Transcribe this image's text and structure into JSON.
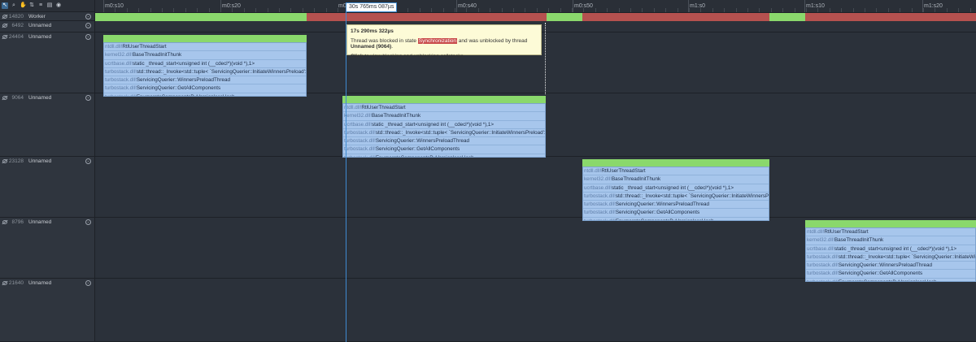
{
  "toolbar": {
    "icons": [
      "select-icon",
      "zoom-icon",
      "pan-icon",
      "sort-icon",
      "filter-icon",
      "document-icon",
      "eye-icon"
    ]
  },
  "ruler": {
    "labels": [
      "m0:s10",
      "m0:s20",
      "m0:s40",
      "m0:s50",
      "m1:s0",
      "m1:s10",
      "m1:s20"
    ],
    "partial_label": "m0"
  },
  "cursor": {
    "label": "30s 765ms 087µs"
  },
  "threads": [
    {
      "id": "14820",
      "name": "Worker"
    },
    {
      "id": "6492",
      "name": "Unnamed"
    },
    {
      "id": "24404",
      "name": "Unnamed"
    },
    {
      "id": "9064",
      "name": "Unnamed"
    },
    {
      "id": "23128",
      "name": "Unnamed"
    },
    {
      "id": "8796",
      "name": "Unnamed"
    },
    {
      "id": "21640",
      "name": "Unnamed"
    }
  ],
  "stacks": {
    "t24404": [
      {
        "mod": "ntdll.dll!",
        "fn": "RtlUserThreadStart"
      },
      {
        "mod": "kernel32.dll!",
        "fn": "BaseThreadInitThunk"
      },
      {
        "mod": "ucrtbase.dll!",
        "fn": "static _thread_start<unsigned int (__cdecl*)(void *),1>"
      },
      {
        "mod": "turbostack.dll!",
        "fn": "std::thread::_Invoke<std::tuple< `ServicingQuerier::InitiateWinnersPreload'::`3'::<l"
      },
      {
        "mod": "turbostack.dll!",
        "fn": "ServicingQuerier::WinnersPreloadThread"
      },
      {
        "mod": "turbostack.dll!",
        "fn": "ServicingQuerier::GetAllComponents"
      },
      {
        "mod": "turbostack.dll!",
        "fn": "EnumerateComponentsByVersionlessHash"
      }
    ],
    "t9064": [
      {
        "mod": "ntdll.dll!",
        "fn": "RtlUserThreadStart"
      },
      {
        "mod": "kernel32.dll!",
        "fn": "BaseThreadInitThunk"
      },
      {
        "mod": "ucrtbase.dll!",
        "fn": "static _thread_start<unsigned int (__cdecl*)(void *),1>"
      },
      {
        "mod": "turbostack.dll!",
        "fn": "std::thread::_Invoke<std::tuple< `ServicingQuerier::InitiateWinnersPreload'::`3'::<l"
      },
      {
        "mod": "turbostack.dll!",
        "fn": "ServicingQuerier::WinnersPreloadThread"
      },
      {
        "mod": "turbostack.dll!",
        "fn": "ServicingQuerier::GetAllComponents"
      },
      {
        "mod": "turbostack.dll!",
        "fn": "EnumerateComponentsByVersionlessHash"
      }
    ],
    "t23128": [
      {
        "mod": "ntdll.dll!",
        "fn": "RtlUserThreadStart"
      },
      {
        "mod": "kernel32.dll!",
        "fn": "BaseThreadInitThunk"
      },
      {
        "mod": "ucrtbase.dll!",
        "fn": "static _thread_start<unsigned int (__cdecl*)(void *),1>"
      },
      {
        "mod": "turbostack.dll!",
        "fn": "std::thread::_Invoke<std::tuple< `ServicingQuerier::InitiateWinnersPreload"
      },
      {
        "mod": "turbostack.dll!",
        "fn": "ServicingQuerier::WinnersPreloadThread"
      },
      {
        "mod": "turbostack.dll!",
        "fn": "ServicingQuerier::GetAllComponents"
      },
      {
        "mod": "turbostack.dll!",
        "fn": "EnumerateComponentsByVersionlessHash"
      }
    ],
    "t8796": [
      {
        "mod": "ntdll.dll!",
        "fn": "RtlUserThreadStart"
      },
      {
        "mod": "kernel32.dll!",
        "fn": "BaseThreadInitThunk"
      },
      {
        "mod": "ucrtbase.dll!",
        "fn": "static _thread_start<unsigned int (__cdecl*)(void *),1>"
      },
      {
        "mod": "turbostack.dll!",
        "fn": "std::thread::_Invoke<std::tuple< `ServicingQuerier::InitiateWinners"
      },
      {
        "mod": "turbostack.dll!",
        "fn": "ServicingQuerier::WinnersPreloadThread"
      },
      {
        "mod": "turbostack.dll!",
        "fn": "ServicingQuerier::GetAllComponents"
      },
      {
        "mod": "turbostack.dll!",
        "fn": "EnumerateComponentsByVersionlessHash"
      }
    ]
  },
  "tooltip": {
    "duration": "17s 290ms 322µs",
    "line_prefix": "Thread was blocked in state ",
    "state": "Synchronization",
    "line_middle": " and was unblocked by thread ",
    "unblocker": "Unnamed (9064)",
    "line_suffix": ".",
    "hint_bold": "Click",
    "hint_rest": " to view blocking and unblocking callstacks."
  },
  "colors": {
    "running": "#8ad86c",
    "blocked": "#b5514f",
    "frame": "#a7c6ec",
    "background": "#2b313a"
  }
}
